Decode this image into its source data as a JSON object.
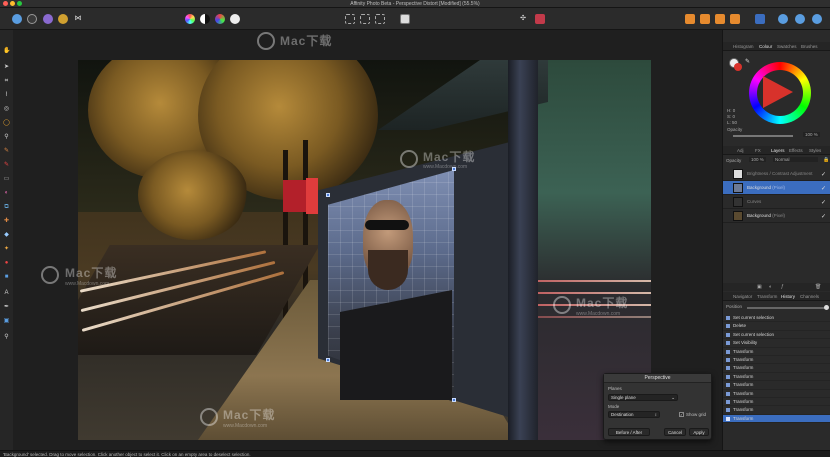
{
  "window": {
    "title": "Affinity Photo Beta - Perspective Distort [Modified] (55.5%)"
  },
  "colors": {
    "accent": "#3b6dbf",
    "close": "#ff5f57",
    "minimize": "#febc2e",
    "maximize": "#28c840"
  },
  "watermark": {
    "text": "Mac下载",
    "url": "www.Macdown.com"
  },
  "right_panel": {
    "top_tabs": [
      "Histogram",
      "Colour",
      "Swatches",
      "Brushes"
    ],
    "color_values": {
      "h": "H: 0",
      "s": "S: 0",
      "l": "L: 50"
    },
    "opacity_label": "Opacity",
    "opacity_value": "100 %",
    "layer_tabs": [
      "Adj",
      "FX",
      "Layers",
      "Effects",
      "Styles"
    ],
    "layer_opacity_label": "Opacity",
    "layer_opacity_value": "100 %",
    "blend_mode": "Normal",
    "layers": [
      {
        "name": "Brightness / Contrast Adjustment",
        "selected": false,
        "dim": true
      },
      {
        "name": "Background",
        "type": "(Pixel)",
        "selected": true,
        "dim": false
      },
      {
        "name": "Curves",
        "selected": false,
        "dim": true
      },
      {
        "name": "Background",
        "type": "(Pixel)",
        "selected": false,
        "dim": false
      }
    ],
    "history_tabs": [
      "Navigator",
      "Transform",
      "History",
      "Channels"
    ],
    "history_position_label": "Position",
    "history": [
      "Set current selection",
      "Delete",
      "Set current selection",
      "Set Visibility",
      "Transform",
      "Transform",
      "Transform",
      "Transform",
      "Transform",
      "Transform",
      "Transform",
      "Transform",
      "Transform"
    ],
    "history_selected_index": 12
  },
  "perspective": {
    "title": "Perspective",
    "planes_label": "Planes",
    "planes_value": "Single plane",
    "mode_label": "Mode",
    "mode_value": "Destination",
    "show_grid_label": "Show grid",
    "before_after": "Before / After",
    "cancel": "Cancel",
    "apply": "Apply"
  },
  "status": {
    "text": "'Background' selected. Drag to move selection. Click another object to select it. Click on an empty area to deselect selection."
  }
}
